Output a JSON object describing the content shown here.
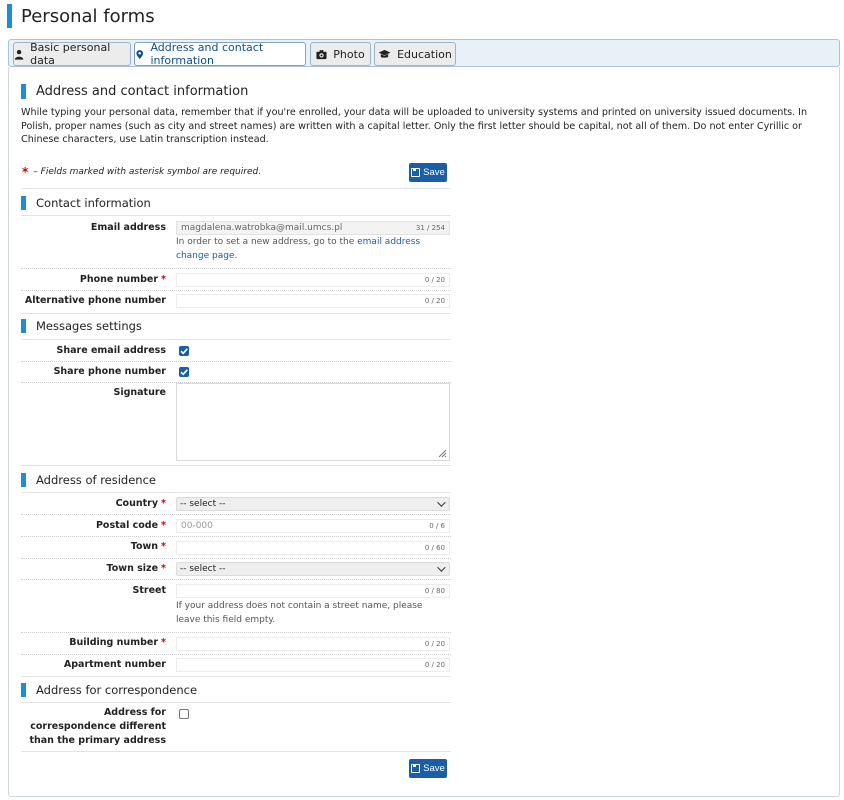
{
  "page": {
    "title": "Personal forms"
  },
  "colors": {
    "accent": "#1a8fd1",
    "button": "#1a5ea8",
    "required": "#d40000"
  },
  "tabs": [
    {
      "label": "Basic personal data",
      "icon": "user-icon",
      "active": false
    },
    {
      "label": "Address and contact information",
      "icon": "map-marker-icon",
      "active": true
    },
    {
      "label": "Photo",
      "icon": "camera-icon",
      "active": false
    },
    {
      "label": "Education",
      "icon": "graduation-cap-icon",
      "active": false
    }
  ],
  "main": {
    "section_title": "Address and contact information",
    "intro": "While typing your personal data, remember that if you're enrolled, your data will be uploaded to university systems and printed on university issued documents. In Polish, proper names (such as city and street names) are written with a capital letter. Only the first letter should be capital, not all of them. Do not enter Cyrillic or Chinese characters, use Latin transcription instead.",
    "required_star": "*",
    "required_note": "– Fields marked with asterisk symbol are required.",
    "save_label": "Save"
  },
  "contact": {
    "title": "Contact information",
    "email": {
      "label": "Email address",
      "value": "magdalena.watrobka@mail.umcs.pl",
      "counter": "31 / 254",
      "help_prefix": "In order to set a new address, go to the ",
      "help_link": "email address change page",
      "help_suffix": "."
    },
    "phone": {
      "label": "Phone number",
      "star": "*",
      "counter": "0 / 20"
    },
    "alt_phone": {
      "label": "Alternative phone number",
      "counter": "0 / 20"
    }
  },
  "messages": {
    "title": "Messages settings",
    "share_email": {
      "label": "Share email address",
      "checked": true
    },
    "share_phone": {
      "label": "Share phone number",
      "checked": true
    },
    "signature": {
      "label": "Signature"
    }
  },
  "residence": {
    "title": "Address of residence",
    "country": {
      "label": "Country",
      "star": "*",
      "value": "-- select --"
    },
    "postal": {
      "label": "Postal code",
      "star": "*",
      "placeholder": "00-000",
      "counter": "0 / 6"
    },
    "town": {
      "label": "Town",
      "star": "*",
      "counter": "0 / 60"
    },
    "town_size": {
      "label": "Town size",
      "star": "*",
      "value": "-- select --"
    },
    "street": {
      "label": "Street",
      "counter": "0 / 80",
      "help": "If your address does not contain a street name, please leave this field empty."
    },
    "building": {
      "label": "Building number",
      "star": "*",
      "counter": "0 / 20"
    },
    "apartment": {
      "label": "Apartment number",
      "counter": "0 / 20"
    }
  },
  "correspondence": {
    "title": "Address for correspondence",
    "different": {
      "label": "Address for correspondence different than the primary address",
      "checked": false
    }
  }
}
